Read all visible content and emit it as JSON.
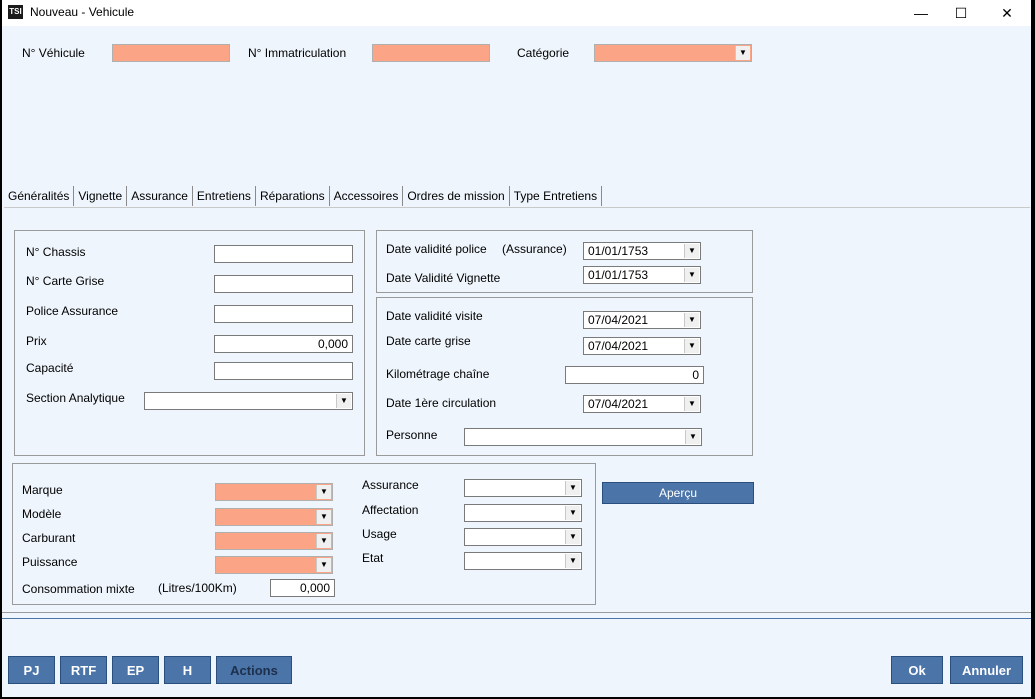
{
  "window": {
    "icon_text": "TSI",
    "title": "Nouveau - Vehicule",
    "minimize": "—",
    "maximize": "☐",
    "close": "✕"
  },
  "header": {
    "vehicule_label": "N° Véhicule",
    "vehicule_value": "",
    "immat_label": "N° Immatriculation",
    "immat_value": "",
    "categorie_label": "Catégorie",
    "categorie_value": ""
  },
  "tabs": [
    "Généralités",
    "Vignette",
    "Assurance",
    "Entretiens",
    "Réparations",
    "Accessoires",
    "Ordres de mission",
    "Type Entretiens"
  ],
  "general": {
    "chassis_label": "N° Chassis",
    "chassis_value": "",
    "carte_label": "N° Carte Grise",
    "carte_value": "",
    "police_label": "Police Assurance",
    "police_value": "",
    "prix_label": "Prix",
    "prix_value": "0,000",
    "capacite_label": "Capacité",
    "capacite_value": "",
    "section_label": "Section Analytique",
    "section_value": ""
  },
  "dates1": {
    "police_label": "Date validité police",
    "police_note": "(Assurance)",
    "police_value": "01/01/1753",
    "vignette_label": "Date Validité Vignette",
    "vignette_value": "01/01/1753"
  },
  "dates2": {
    "visite_label": "Date validité visite",
    "visite_value": "07/04/2021",
    "carte_label": "Date carte grise",
    "carte_value": "07/04/2021",
    "km_label": "Kilométrage chaîne",
    "km_value": "0",
    "circ_label": "Date 1ère circulation",
    "circ_value": "07/04/2021",
    "personne_label": "Personne",
    "personne_value": ""
  },
  "specs": {
    "marque_label": "Marque",
    "modele_label": "Modèle",
    "carburant_label": "Carburant",
    "puissance_label": "Puissance",
    "conso_label": "Consommation mixte",
    "conso_unit": "(Litres/100Km)",
    "conso_value": "0,000",
    "assurance_label": "Assurance",
    "affectation_label": "Affectation",
    "usage_label": "Usage",
    "etat_label": "Etat"
  },
  "apercu_label": "Aperçu",
  "footer": {
    "pj": "PJ",
    "rtf": "RTF",
    "ep": "EP",
    "h": "H",
    "actions": "Actions",
    "ok": "Ok",
    "annuler": "Annuler"
  }
}
